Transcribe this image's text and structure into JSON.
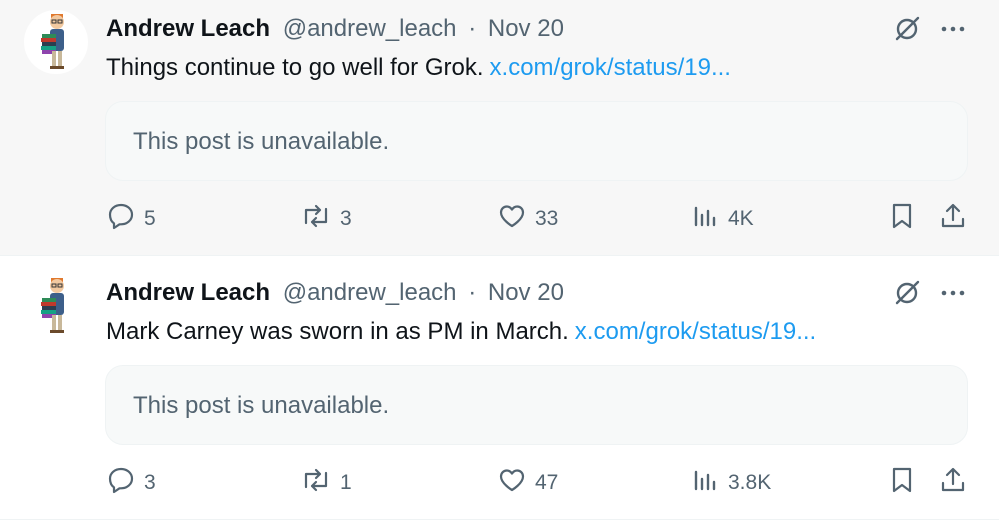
{
  "posts": [
    {
      "author": {
        "name": "Andrew Leach",
        "handle": "@andrew_leach"
      },
      "separator": "·",
      "date": "Nov 20",
      "text": "Things continue to go well for Grok.",
      "link": "x.com/grok/status/19...",
      "quote_text": "This post is unavailable.",
      "stats": {
        "replies": "5",
        "reposts": "3",
        "likes": "33",
        "views": "4K"
      }
    },
    {
      "author": {
        "name": "Andrew Leach",
        "handle": "@andrew_leach"
      },
      "separator": "·",
      "date": "Nov 20",
      "text": "Mark Carney was sworn in as PM in March.",
      "link": "x.com/grok/status/19...",
      "quote_text": "This post is unavailable.",
      "stats": {
        "replies": "3",
        "reposts": "1",
        "likes": "47",
        "views": "3.8K"
      }
    }
  ],
  "icons": {
    "grok": "grok-icon",
    "more": "more-icon",
    "reply": "reply-icon",
    "repost": "repost-icon",
    "like": "heart-icon",
    "views": "views-icon",
    "bookmark": "bookmark-icon",
    "share": "share-icon"
  },
  "colors": {
    "link": "#1d9bf0",
    "secondary_text": "#536471",
    "hover_bg": "#f7f7f7"
  }
}
